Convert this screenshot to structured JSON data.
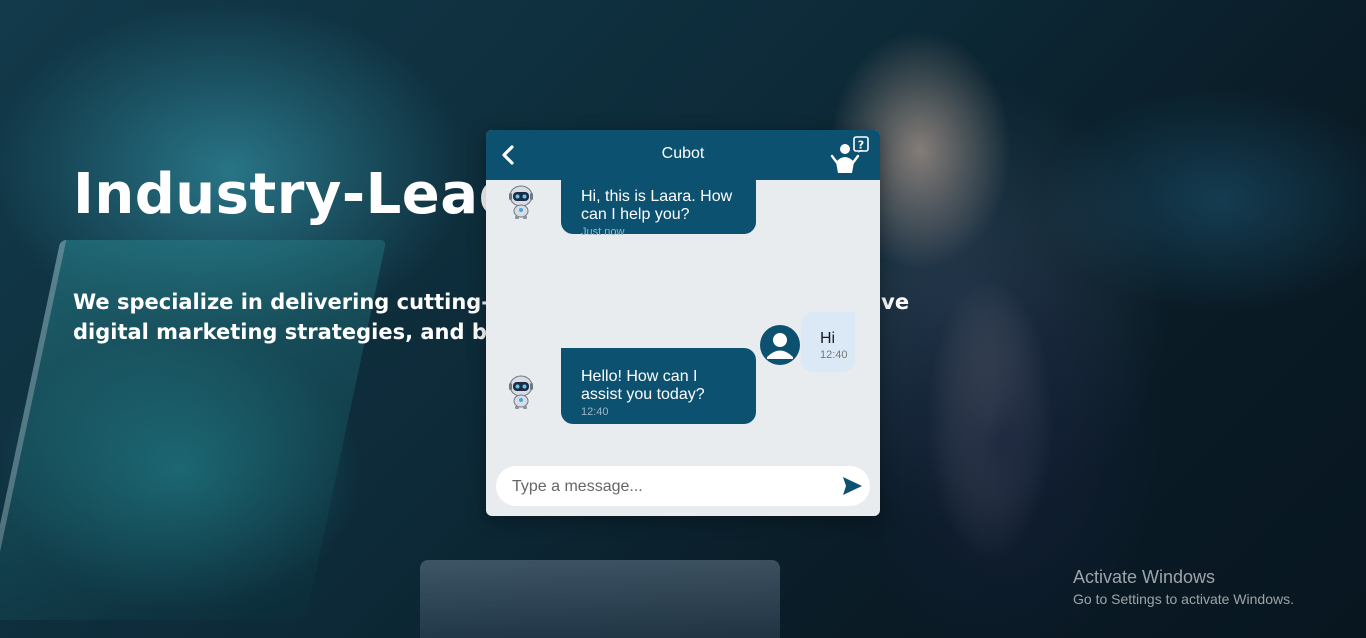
{
  "hero": {
    "title": "Industry-Lead",
    "subtitle_line1": "We specialize in delivering cutting-e",
    "subtitle_line1_tail": "ensive",
    "subtitle_line2": "digital marketing strategies, and besp"
  },
  "chat": {
    "title": "Cubot",
    "header_icons": {
      "back": "chevron-left-icon",
      "help": "support-agent-question-icon"
    },
    "colors": {
      "header": "#0d5170",
      "bot_bubble": "#0d5170",
      "user_bubble": "#dbe9f7",
      "panel": "#e9ecef"
    },
    "messages": [
      {
        "sender": "bot",
        "text": "Hi, this is Laara. How can I help you?",
        "time": "Just now"
      },
      {
        "sender": "user",
        "text": "Hi",
        "time": "12:40"
      },
      {
        "sender": "bot",
        "text": "Hello! How can I assist you today?",
        "time": "12:40"
      }
    ],
    "input": {
      "placeholder": "Type a message...",
      "value": ""
    },
    "send_icon": "send-icon"
  },
  "watermark": {
    "title": "Activate Windows",
    "subtitle": "Go to Settings to activate Windows."
  }
}
